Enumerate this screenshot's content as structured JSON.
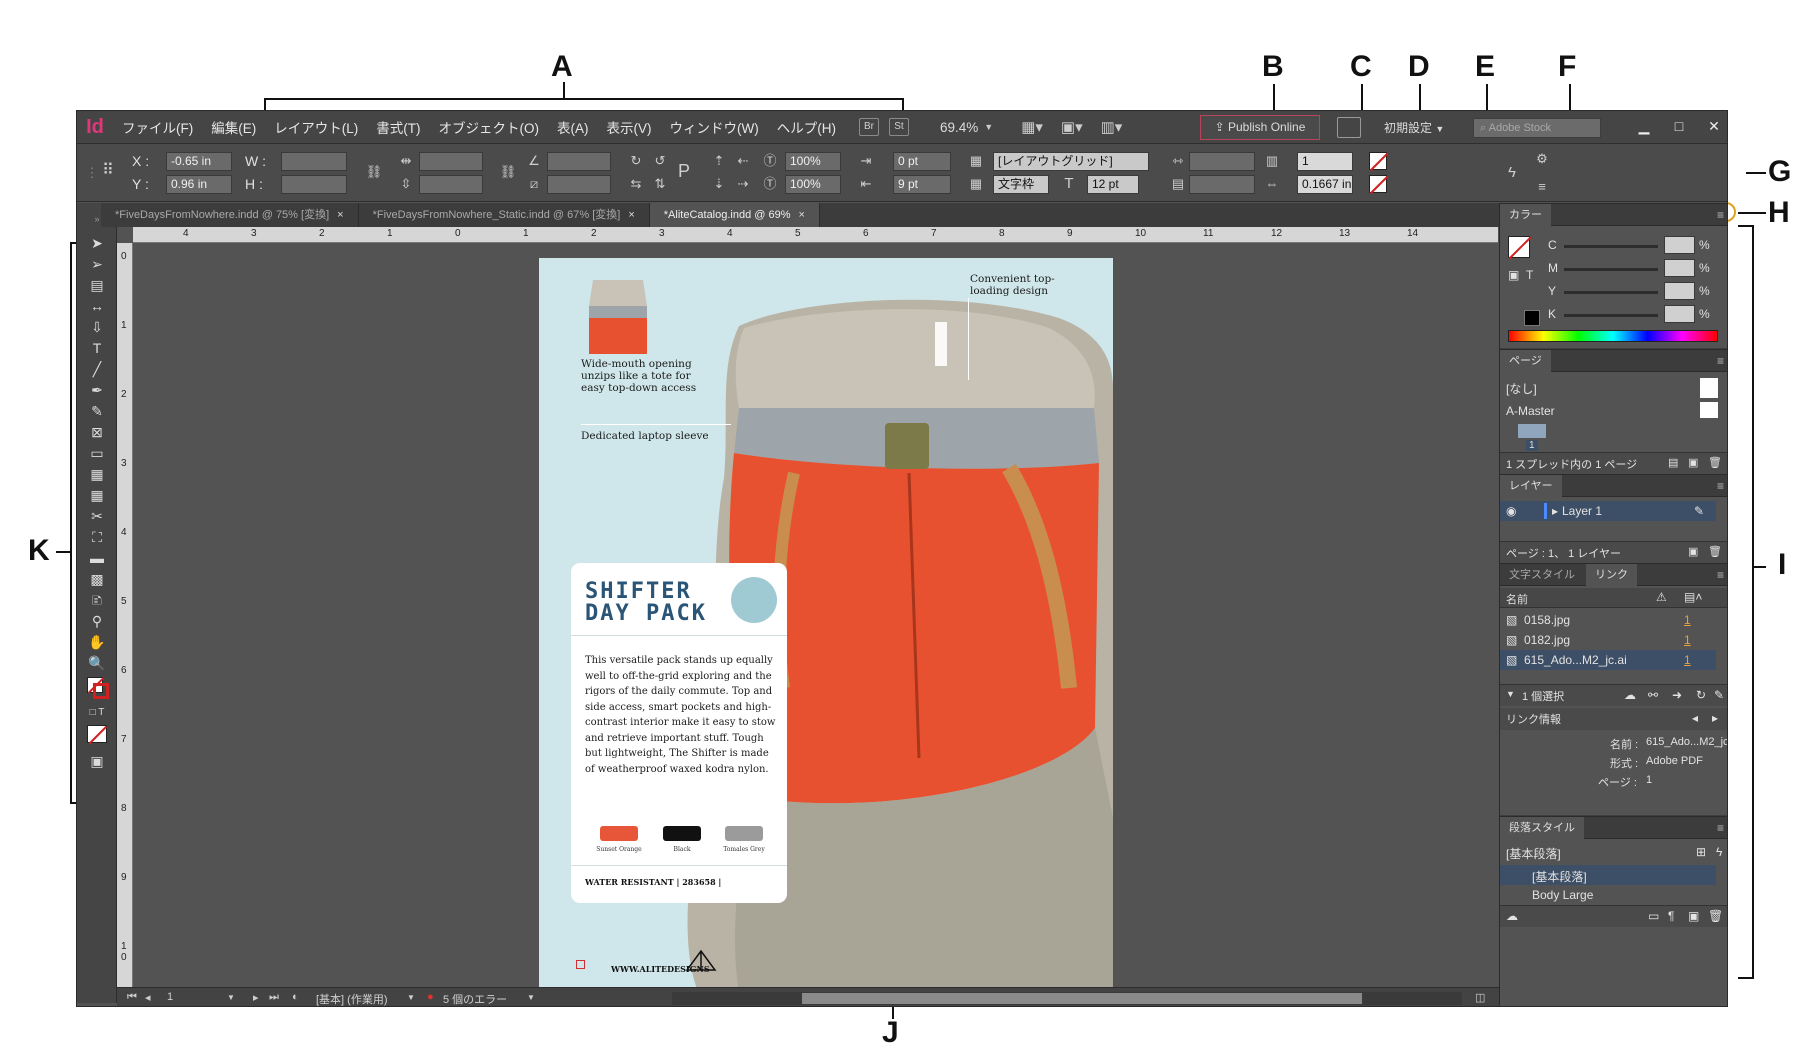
{
  "callouts": {
    "a": "A",
    "b": "B",
    "c": "C",
    "d": "D",
    "e": "E",
    "f": "F",
    "g": "G",
    "h": "H",
    "i": "I",
    "j": "J",
    "k": "K"
  },
  "menubar": {
    "logo": "Id",
    "items": [
      "ファイル(F)",
      "編集(E)",
      "レイアウト(L)",
      "書式(T)",
      "オブジェクト(O)",
      "表(A)",
      "表示(V)",
      "ウィンドウ(W)",
      "ヘルプ(H)"
    ],
    "bridge": "Br",
    "stock_btn": "St",
    "zoom": "69.4%",
    "publish": "Publish Online",
    "workspace": "初期設定",
    "search_placeholder": "Adobe Stock"
  },
  "control": {
    "x_label": "X :",
    "x_value": "-0.65 in",
    "y_label": "Y :",
    "y_value": "0.96 in",
    "w_label": "W :",
    "h_label": "H :",
    "scale_x": "100%",
    "scale_y": "100%",
    "offset_1": "0 pt",
    "offset_2": "9 pt",
    "grid": "[レイアウトグリッド]",
    "frame_type": "文字枠",
    "font_size": "12 pt",
    "columns": "1",
    "gutter": "0.1667 in"
  },
  "tabs": [
    {
      "label": "*FiveDaysFromNowhere.indd @ 75% [変換]",
      "close": "×"
    },
    {
      "label": "*FiveDaysFromNowhere_Static.indd @ 67% [変換]",
      "close": "×"
    },
    {
      "label": "*AliteCatalog.indd @ 69%",
      "close": "×"
    }
  ],
  "rulers": {
    "h": [
      "4",
      "3",
      "2",
      "1",
      "0",
      "1",
      "2",
      "3",
      "4",
      "5",
      "6",
      "7",
      "8",
      "9",
      "10",
      "11",
      "12",
      "13",
      "14"
    ],
    "v": [
      "0",
      "1",
      "2",
      "3",
      "4",
      "5",
      "6",
      "7",
      "8",
      "9",
      "1 0"
    ]
  },
  "page": {
    "caption_top": "Convenient top-\nloading design",
    "caption_tote": "Wide-mouth opening\nunzips like a tote for\neasy top-down access",
    "caption_laptop": "Dedicated laptop sleeve",
    "card_title": "SHIFTER\nDAY PACK",
    "card_body": "This versatile pack stands up equally well to off-the-grid exploring and the rigors of the daily commute. Top and side access, smart pockets and high-contrast interior make it easy to stow and retrieve important stuff. Tough but lightweight, The Shifter is made of weatherproof waxed kodra nylon.",
    "swatches": [
      {
        "name": "Sunset Orange",
        "color": "#e8563a"
      },
      {
        "name": "Black",
        "color": "#111111"
      },
      {
        "name": "Tomales Grey",
        "color": "#9b9b9b"
      }
    ],
    "water": "WATER RESISTANT | 283658 |",
    "url": "WWW.ALITEDESIGNS"
  },
  "status": {
    "page": "1",
    "profile": "[基本] (作業用)",
    "errors": "5 個のエラー"
  },
  "panels": {
    "color": {
      "tab": "カラー",
      "channels": [
        "C",
        "M",
        "Y",
        "K"
      ],
      "percent": "%",
      "text_icon": "T"
    },
    "pages": {
      "tab": "ページ",
      "none": "[なし]",
      "master": "A-Master",
      "page_num": "1",
      "status": "1 スプレッド内の 1 ページ"
    },
    "layers": {
      "tab": "レイヤー",
      "layer": "Layer 1",
      "status": "ページ : 1、 1 レイヤー"
    },
    "links": {
      "tab_inactive": "文字スタイル",
      "tab": "リンク",
      "col_name": "名前",
      "files": [
        {
          "name": "0158.jpg",
          "page": "1"
        },
        {
          "name": "0182.jpg",
          "page": "1"
        },
        {
          "name": "615_Ado...M2_jc.ai",
          "page": "1"
        }
      ],
      "selected": "1 個選択",
      "info_title": "リンク情報",
      "info": [
        {
          "label": "名前 :",
          "value": "615_Ado...M2_jc.ai"
        },
        {
          "label": "形式 :",
          "value": "Adobe PDF"
        },
        {
          "label": "ページ :",
          "value": "1"
        }
      ]
    },
    "para": {
      "tab": "段落スタイル",
      "current": "[基本段落]",
      "items": [
        "[基本段落]",
        "Body Large"
      ]
    }
  },
  "colors": {
    "accent": "#e0377b",
    "publish_border": "#b8445b",
    "selection": "#3d4f66"
  }
}
